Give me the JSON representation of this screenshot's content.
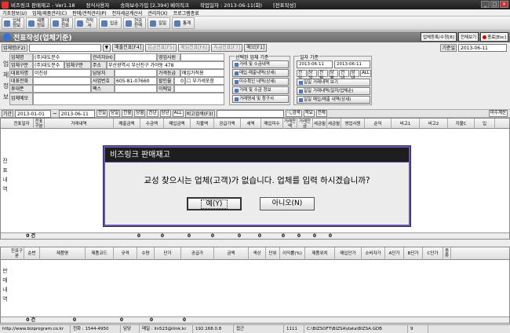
{
  "title_bar": {
    "app": "비즈링크 판매재고 - Ver1.18",
    "mode": "정식사용자",
    "user": "송파보수가입 [2,394] 베이직크",
    "date": "작업일자 : 2013-06-11(화)",
    "screen": "[전표작성]"
  },
  "menu": [
    "기초정보(U)",
    "업체/제품관리(C)",
    "판매/견적관리(P)",
    "전자세금계산서",
    "관리자(X)",
    "프로그램종료"
  ],
  "toolbar": [
    "업체정보",
    "제품정보",
    "판매전표",
    "견적서",
    "입금",
    "현금잔액",
    "일일",
    "통계"
  ],
  "section": {
    "title": "전표작성(업체기준)"
  },
  "right_buttons": [
    "업체등록/수정[8]",
    "전체보기",
    "종료[Esc]"
  ],
  "row1": {
    "lookup_label": "업체명(F2)",
    "buttons": [
      "매출전표[F4]",
      "입금전표[F5]",
      "매입전표[F6]",
      "지급전표[F7]",
      "메모[F1]"
    ],
    "date_label": "기준일",
    "date_value": "2013-06-11"
  },
  "side_label": "업체정보",
  "company": {
    "name_label": "업체명",
    "name": "(주)대도문수",
    "mgr_label": "관리자(H)",
    "type_label": "업체구분",
    "type": "(주)대도문수",
    "type2": "업체구분",
    "addr_label": "주소",
    "addr": "부산광역시 부산진구 가야동 478",
    "ceo_label": "대표자명",
    "ceo": "이진성",
    "charge_label": "담당자",
    "price_label": "가격등급",
    "price": "매입가적용",
    "tel_label": "대표전화",
    "bizno_label": "사업번호",
    "bizno": "605-81-07660",
    "disc_label": "할인율",
    "disc": "0",
    "vat": "부가세포함",
    "mobile_label": "휴대폰",
    "fax_label": "팩스",
    "email_label": "이메일",
    "memo_label": "업체메모"
  },
  "group1": {
    "title": "선택된 업체 기준",
    "buttons": [
      "거래 및 수금내역",
      "매입·매출내역(상세)",
      "미수확인 내역(상세)",
      "거래 및 수금 정보",
      "거래명세 및 청구서"
    ]
  },
  "group2": {
    "title": "일자 기준",
    "from": "2013-06-11",
    "to": "2013-06-11",
    "chips": [
      "전일",
      "당일",
      "전월",
      "당월",
      "전년",
      "당년",
      "ALL"
    ],
    "buttons": [
      "일일 거래내역 보기",
      "일일 거래내역(일자/업체순)",
      "일일 매입/매출 내역(상세)"
    ]
  },
  "filter": {
    "label": "기간",
    "from": "2013-01-01",
    "to": "2013-06-11",
    "chips": [
      "전일",
      "당일",
      "전월",
      "당월",
      "전년",
      "당년",
      "ALL"
    ],
    "item_label": "비고검색(F3)",
    "buttons": [
      "검색",
      "적요",
      "전체",
      "미수계산"
    ]
  },
  "grid_a": {
    "side_label": "전표내역",
    "columns": [
      "전표일자",
      "전표구분",
      "거래내역",
      "매출금액",
      "수금액",
      "매입금액",
      "지불액",
      "공급가액",
      "세액",
      "매입미수",
      "거래잔액",
      "거래잔금",
      "세금월",
      "세금월",
      "영업사원",
      "순익",
      "비고1",
      "비고2",
      "지불C",
      "입"
    ],
    "footer_count": "0 건",
    "footer_values": [
      "0",
      "0",
      "0",
      "0",
      "0",
      "0",
      "0",
      "0",
      "0",
      "0"
    ]
  },
  "grid_b": {
    "side_label": "판매내역",
    "columns": [
      "전표구분",
      "순번",
      "제품명",
      "제품코드",
      "규격",
      "수량",
      "단가",
      "공급가",
      "금액",
      "색상",
      "단위",
      "이익률(%)",
      "제품위치",
      "매입단가",
      "소비자가",
      "A단가",
      "B단가",
      "C단가",
      "종류"
    ],
    "footer_count": "0 건",
    "footer_values": [
      "0",
      "0",
      "0",
      "0"
    ]
  },
  "status": [
    "http://www.bizprogram.co.kr",
    "전화 : 1544-4950",
    "담당",
    "메일 : lin523@ilink.kr",
    "192.168.0.8",
    "접근",
    "1111",
    "C:\\BIZSOFT\\BIZSA\\data\\BIZSA.GDB",
    "9"
  ],
  "dialog": {
    "title": "비즈링크 판매재고",
    "message": "교성 찾으시는 업체(고객)가 없습니다. 업체를 입력 하시겠습니까?",
    "yes": "예(Y)",
    "no": "아니오(N)"
  }
}
